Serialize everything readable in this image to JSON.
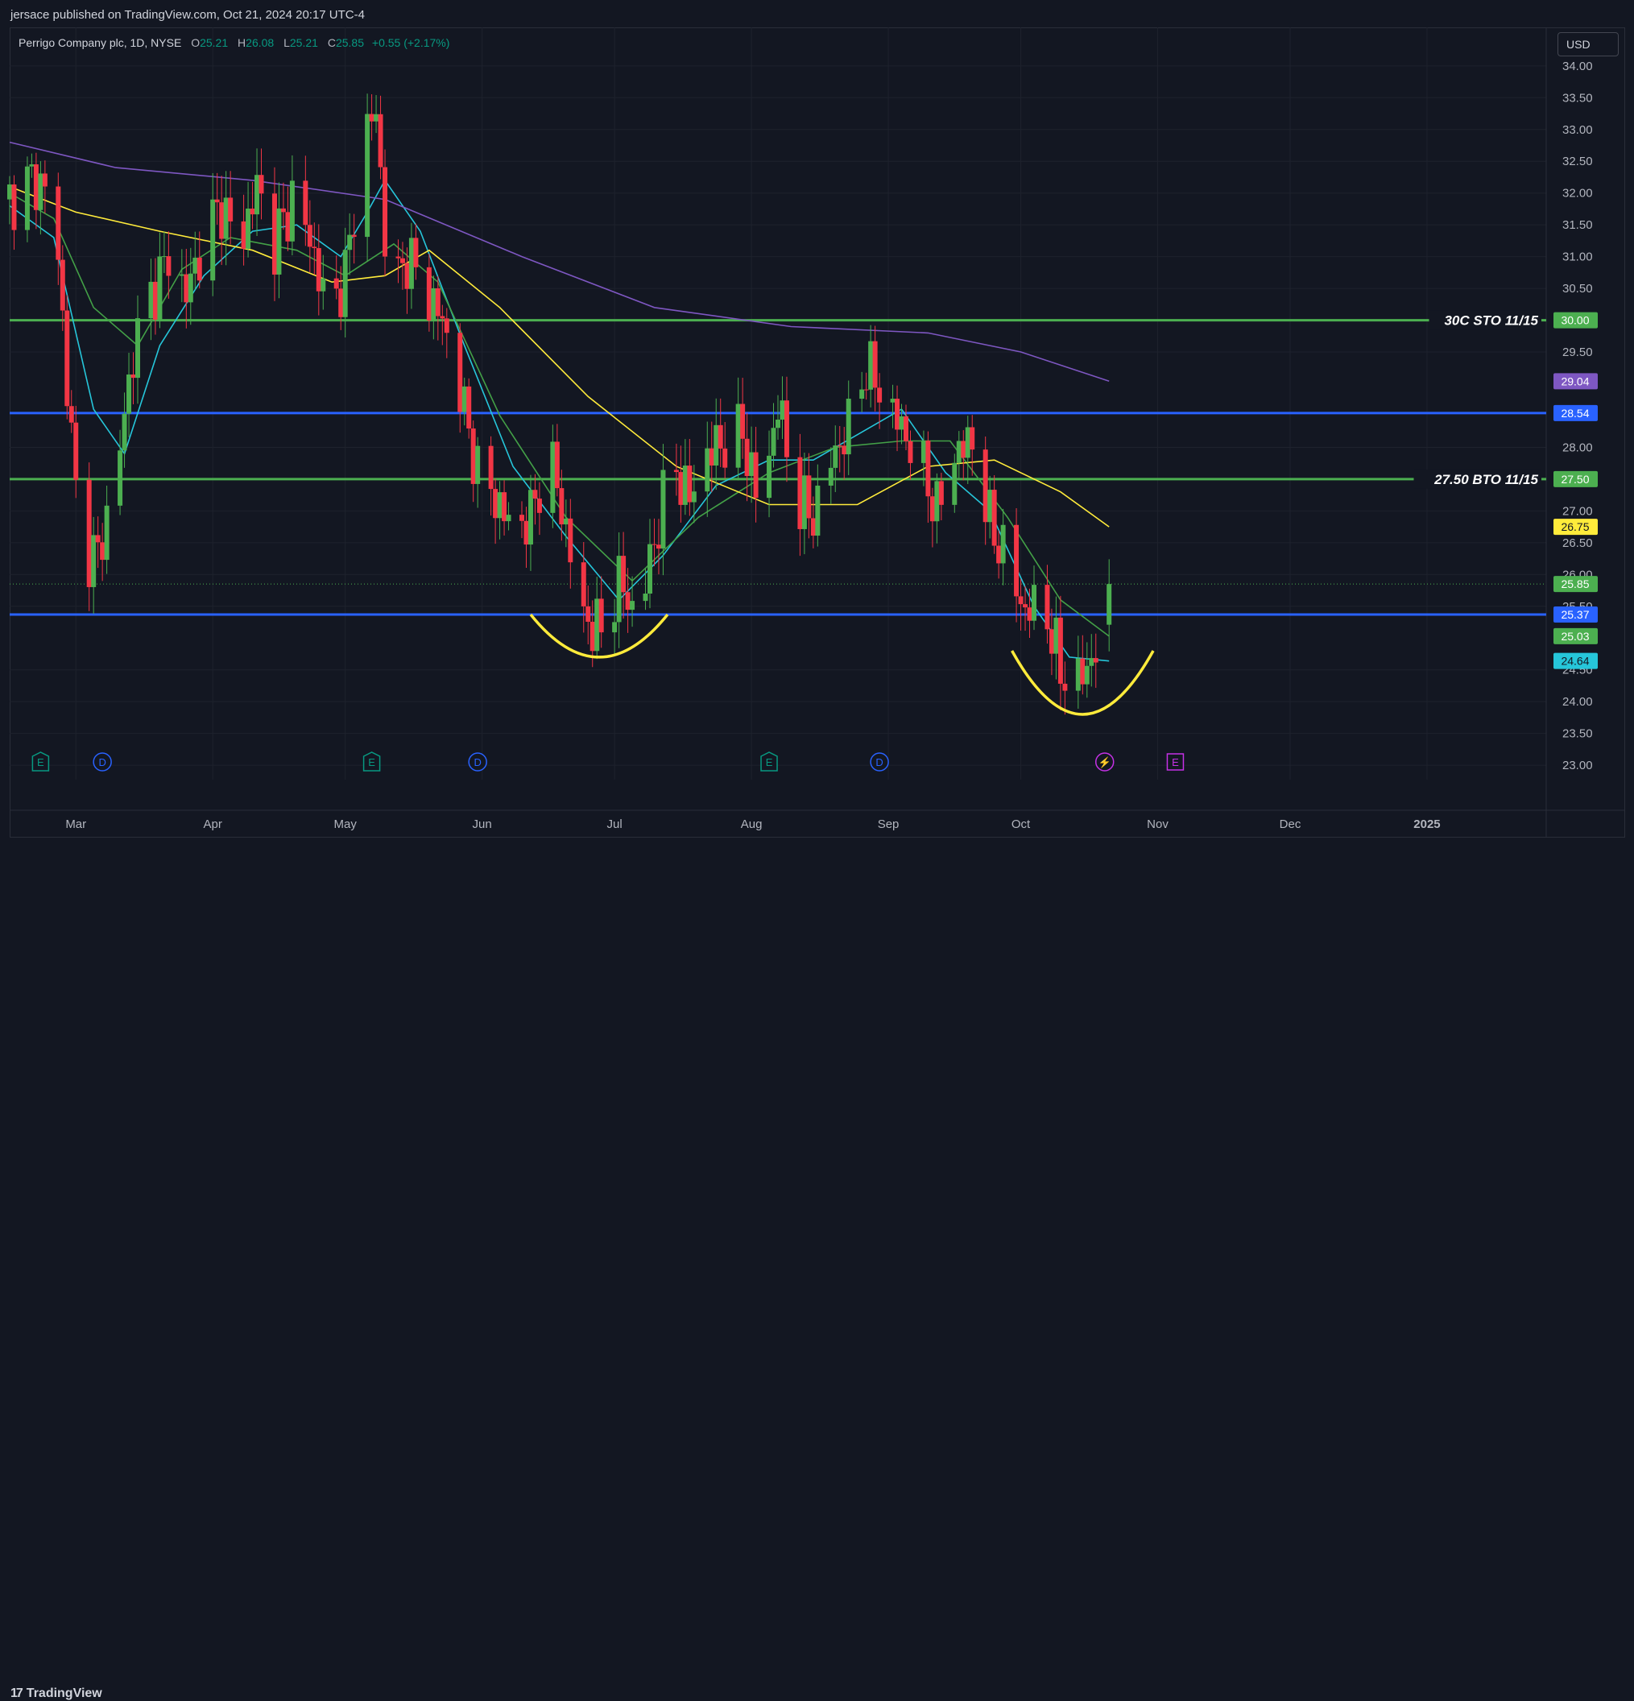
{
  "header": {
    "publisher_line": "jersace published on TradingView.com, Oct 21, 2024 20:17 UTC-4"
  },
  "legend": {
    "symbol": "Perrigo Company plc, 1D, NYSE",
    "open_key": "O",
    "open": "25.21",
    "high_key": "H",
    "high": "26.08",
    "low_key": "L",
    "low": "25.21",
    "close_key": "C",
    "close": "25.85",
    "change": "+0.55 (+2.17%)"
  },
  "currency_button": "USD",
  "footer": {
    "brand": "TradingView",
    "brand_mark": "17"
  },
  "colors": {
    "background": "#131722",
    "grid": "#1e222d",
    "up": "#4caf50",
    "down": "#f23645",
    "ma_fast": "#26c6da",
    "ma_mid": "#43a047",
    "ma_slow": "#ffeb3b",
    "ma_long": "#7e57c2",
    "level_green": "#4caf50",
    "level_blue": "#2962ff",
    "pattern": "#ffeb3b"
  },
  "chart_data": {
    "type": "candlestick",
    "title": "Perrigo Company plc, 1D, NYSE",
    "ylim": [
      22.9,
      34.15
    ],
    "y_ticks": [
      "34.00",
      "33.50",
      "33.00",
      "32.50",
      "32.00",
      "31.50",
      "31.00",
      "30.50",
      "29.50",
      "28.00",
      "27.00",
      "26.50",
      "26.00",
      "25.50",
      "24.50",
      "24.00",
      "23.50",
      "23.00"
    ],
    "x_ticks": [
      "Mar",
      "Apr",
      "May",
      "Jun",
      "Jul",
      "Aug",
      "Sep",
      "Oct",
      "Nov",
      "Dec",
      "2025"
    ],
    "x_tick_dates": [
      "2024-03-01",
      "2024-04-01",
      "2024-05-01",
      "2024-06-01",
      "2024-07-01",
      "2024-08-01",
      "2024-09-01",
      "2024-10-01",
      "2024-11-01",
      "2024-12-01",
      "2025-01-01"
    ],
    "x_range": [
      "2024-02-15",
      "2025-01-28"
    ],
    "last_bar_date": "2024-10-21",
    "grid": true,
    "candle_points": [
      [
        "2024-02-15",
        31.9
      ],
      [
        "2024-02-20",
        32.2
      ],
      [
        "2024-02-25",
        32.0
      ],
      [
        "2024-02-28",
        29.0
      ],
      [
        "2024-03-02",
        26.4
      ],
      [
        "2024-03-06",
        26.3
      ],
      [
        "2024-03-10",
        27.5
      ],
      [
        "2024-03-14",
        29.5
      ],
      [
        "2024-03-18",
        30.4
      ],
      [
        "2024-03-22",
        31.0
      ],
      [
        "2024-03-26",
        30.4
      ],
      [
        "2024-03-30",
        31.3
      ],
      [
        "2024-04-03",
        31.8
      ],
      [
        "2024-04-07",
        31.1
      ],
      [
        "2024-04-11",
        32.1
      ],
      [
        "2024-04-15",
        31.2
      ],
      [
        "2024-04-19",
        31.9
      ],
      [
        "2024-04-23",
        31.3
      ],
      [
        "2024-04-27",
        30.1
      ],
      [
        "2024-05-01",
        30.7
      ],
      [
        "2024-05-05",
        32.8
      ],
      [
        "2024-05-08",
        33.3
      ],
      [
        "2024-05-11",
        30.3
      ],
      [
        "2024-05-15",
        31.0
      ],
      [
        "2024-05-19",
        30.5
      ],
      [
        "2024-05-23",
        30.0
      ],
      [
        "2024-05-27",
        28.9
      ],
      [
        "2024-05-31",
        27.6
      ],
      [
        "2024-06-04",
        27.2
      ],
      [
        "2024-06-08",
        26.7
      ],
      [
        "2024-06-12",
        26.9
      ],
      [
        "2024-06-16",
        28.0
      ],
      [
        "2024-06-20",
        26.7
      ],
      [
        "2024-06-24",
        25.3
      ],
      [
        "2024-06-28",
        25.1
      ],
      [
        "2024-07-02",
        25.9
      ],
      [
        "2024-07-06",
        25.3
      ],
      [
        "2024-07-10",
        26.5
      ],
      [
        "2024-07-14",
        27.8
      ],
      [
        "2024-07-18",
        27.2
      ],
      [
        "2024-07-22",
        27.9
      ],
      [
        "2024-07-26",
        28.1
      ],
      [
        "2024-07-30",
        28.2
      ],
      [
        "2024-08-03",
        27.0
      ],
      [
        "2024-08-07",
        28.7
      ],
      [
        "2024-08-11",
        27.2
      ],
      [
        "2024-08-15",
        26.9
      ],
      [
        "2024-08-19",
        27.8
      ],
      [
        "2024-08-23",
        28.3
      ],
      [
        "2024-08-27",
        29.3
      ],
      [
        "2024-08-31",
        28.8
      ],
      [
        "2024-09-04",
        28.3
      ],
      [
        "2024-09-08",
        27.8
      ],
      [
        "2024-09-12",
        27.0
      ],
      [
        "2024-09-16",
        27.9
      ],
      [
        "2024-09-20",
        28.1
      ],
      [
        "2024-09-24",
        26.8
      ],
      [
        "2024-09-28",
        26.2
      ],
      [
        "2024-10-02",
        25.4
      ],
      [
        "2024-10-06",
        25.6
      ],
      [
        "2024-10-10",
        24.5
      ],
      [
        "2024-10-14",
        24.3
      ],
      [
        "2024-10-18",
        24.8
      ],
      [
        "2024-10-21",
        25.85
      ]
    ],
    "moving_averages": [
      {
        "color_key": "ma_fast",
        "points": [
          [
            "2024-02-15",
            31.8
          ],
          [
            "2024-02-25",
            31.3
          ],
          [
            "2024-03-05",
            28.6
          ],
          [
            "2024-03-12",
            27.9
          ],
          [
            "2024-03-20",
            29.6
          ],
          [
            "2024-03-30",
            30.7
          ],
          [
            "2024-04-10",
            31.4
          ],
          [
            "2024-04-20",
            31.5
          ],
          [
            "2024-04-30",
            31.0
          ],
          [
            "2024-05-06",
            31.7
          ],
          [
            "2024-05-10",
            32.2
          ],
          [
            "2024-05-18",
            31.4
          ],
          [
            "2024-05-28",
            29.6
          ],
          [
            "2024-06-08",
            27.7
          ],
          [
            "2024-06-20",
            26.6
          ],
          [
            "2024-07-02",
            25.6
          ],
          [
            "2024-07-12",
            26.3
          ],
          [
            "2024-07-24",
            27.4
          ],
          [
            "2024-08-05",
            27.8
          ],
          [
            "2024-08-15",
            27.8
          ],
          [
            "2024-08-25",
            28.2
          ],
          [
            "2024-09-04",
            28.6
          ],
          [
            "2024-09-14",
            27.6
          ],
          [
            "2024-09-24",
            27.0
          ],
          [
            "2024-10-04",
            25.5
          ],
          [
            "2024-10-12",
            24.7
          ],
          [
            "2024-10-21",
            24.64
          ]
        ]
      },
      {
        "color_key": "ma_mid",
        "points": [
          [
            "2024-02-15",
            32.0
          ],
          [
            "2024-02-25",
            31.6
          ],
          [
            "2024-03-05",
            30.2
          ],
          [
            "2024-03-15",
            29.6
          ],
          [
            "2024-03-25",
            30.8
          ],
          [
            "2024-04-05",
            31.3
          ],
          [
            "2024-04-20",
            31.1
          ],
          [
            "2024-05-01",
            30.7
          ],
          [
            "2024-05-12",
            31.2
          ],
          [
            "2024-05-22",
            30.6
          ],
          [
            "2024-06-05",
            28.5
          ],
          [
            "2024-06-20",
            26.9
          ],
          [
            "2024-07-05",
            25.9
          ],
          [
            "2024-07-20",
            26.9
          ],
          [
            "2024-08-05",
            27.6
          ],
          [
            "2024-08-20",
            28.0
          ],
          [
            "2024-09-04",
            28.1
          ],
          [
            "2024-09-15",
            28.1
          ],
          [
            "2024-09-28",
            26.9
          ],
          [
            "2024-10-10",
            25.6
          ],
          [
            "2024-10-21",
            25.03
          ]
        ]
      },
      {
        "color_key": "ma_slow",
        "points": [
          [
            "2024-02-15",
            32.1
          ],
          [
            "2024-03-01",
            31.7
          ],
          [
            "2024-03-20",
            31.4
          ],
          [
            "2024-04-10",
            31.1
          ],
          [
            "2024-04-28",
            30.6
          ],
          [
            "2024-05-10",
            30.7
          ],
          [
            "2024-05-20",
            31.1
          ],
          [
            "2024-06-05",
            30.2
          ],
          [
            "2024-06-25",
            28.8
          ],
          [
            "2024-07-15",
            27.7
          ],
          [
            "2024-08-05",
            27.1
          ],
          [
            "2024-08-25",
            27.1
          ],
          [
            "2024-09-10",
            27.7
          ],
          [
            "2024-09-25",
            27.8
          ],
          [
            "2024-10-10",
            27.3
          ],
          [
            "2024-10-21",
            26.75
          ]
        ]
      },
      {
        "color_key": "ma_long",
        "points": [
          [
            "2024-02-15",
            32.8
          ],
          [
            "2024-03-10",
            32.4
          ],
          [
            "2024-04-10",
            32.2
          ],
          [
            "2024-05-10",
            31.9
          ],
          [
            "2024-06-10",
            31.0
          ],
          [
            "2024-07-10",
            30.2
          ],
          [
            "2024-08-10",
            29.9
          ],
          [
            "2024-09-10",
            29.8
          ],
          [
            "2024-10-01",
            29.5
          ],
          [
            "2024-10-21",
            29.04
          ]
        ]
      }
    ],
    "horizontal_levels": [
      {
        "price": 30.0,
        "color_key": "level_green",
        "label": "30C STO 11/15"
      },
      {
        "price": 28.54,
        "color_key": "level_blue",
        "label": ""
      },
      {
        "price": 27.5,
        "color_key": "level_green",
        "label": "27.50 BTO 11/15"
      },
      {
        "price": 25.37,
        "color_key": "level_blue",
        "label": ""
      }
    ],
    "price_tags": [
      {
        "value": "30.00",
        "price": 30.0,
        "bg": "#4caf50",
        "fg": "#ffffff"
      },
      {
        "value": "29.04",
        "price": 29.04,
        "bg": "#7e57c2",
        "fg": "#ffffff"
      },
      {
        "value": "28.54",
        "price": 28.54,
        "bg": "#2962ff",
        "fg": "#ffffff"
      },
      {
        "value": "27.50",
        "price": 27.5,
        "bg": "#4caf50",
        "fg": "#ffffff"
      },
      {
        "value": "26.75",
        "price": 26.75,
        "bg": "#ffeb3b",
        "fg": "#131722"
      },
      {
        "value": "25.85",
        "price": 25.85,
        "bg": "#4caf50",
        "fg": "#ffffff"
      },
      {
        "value": "25.37",
        "price": 25.37,
        "bg": "#2962ff",
        "fg": "#ffffff"
      },
      {
        "value": "25.03",
        "price": 25.03,
        "bg": "#4caf50",
        "fg": "#ffffff"
      },
      {
        "value": "24.64",
        "price": 24.64,
        "bg": "#26c6da",
        "fg": "#131722"
      }
    ],
    "pattern_curves": [
      {
        "from": "2024-06-12",
        "to": "2024-07-13",
        "top": 25.37,
        "bottom": 24.7
      },
      {
        "from": "2024-09-29",
        "to": "2024-10-31",
        "top": 24.8,
        "bottom": 23.8
      }
    ],
    "events": [
      {
        "date": "2024-02-22",
        "letter": "E",
        "color": "#089981",
        "shape": "pentagon"
      },
      {
        "date": "2024-03-07",
        "letter": "D",
        "color": "#2962ff",
        "shape": "circle"
      },
      {
        "date": "2024-05-07",
        "letter": "E",
        "color": "#089981",
        "shape": "pentagon"
      },
      {
        "date": "2024-05-31",
        "letter": "D",
        "color": "#2962ff",
        "shape": "circle"
      },
      {
        "date": "2024-08-05",
        "letter": "E",
        "color": "#089981",
        "shape": "pentagon"
      },
      {
        "date": "2024-08-30",
        "letter": "D",
        "color": "#2962ff",
        "shape": "circle"
      },
      {
        "date": "2024-10-20",
        "letter": "⚡",
        "color": "#c531e6",
        "shape": "circle"
      },
      {
        "date": "2024-11-05",
        "letter": "E",
        "color": "#c531e6",
        "shape": "square"
      }
    ]
  }
}
